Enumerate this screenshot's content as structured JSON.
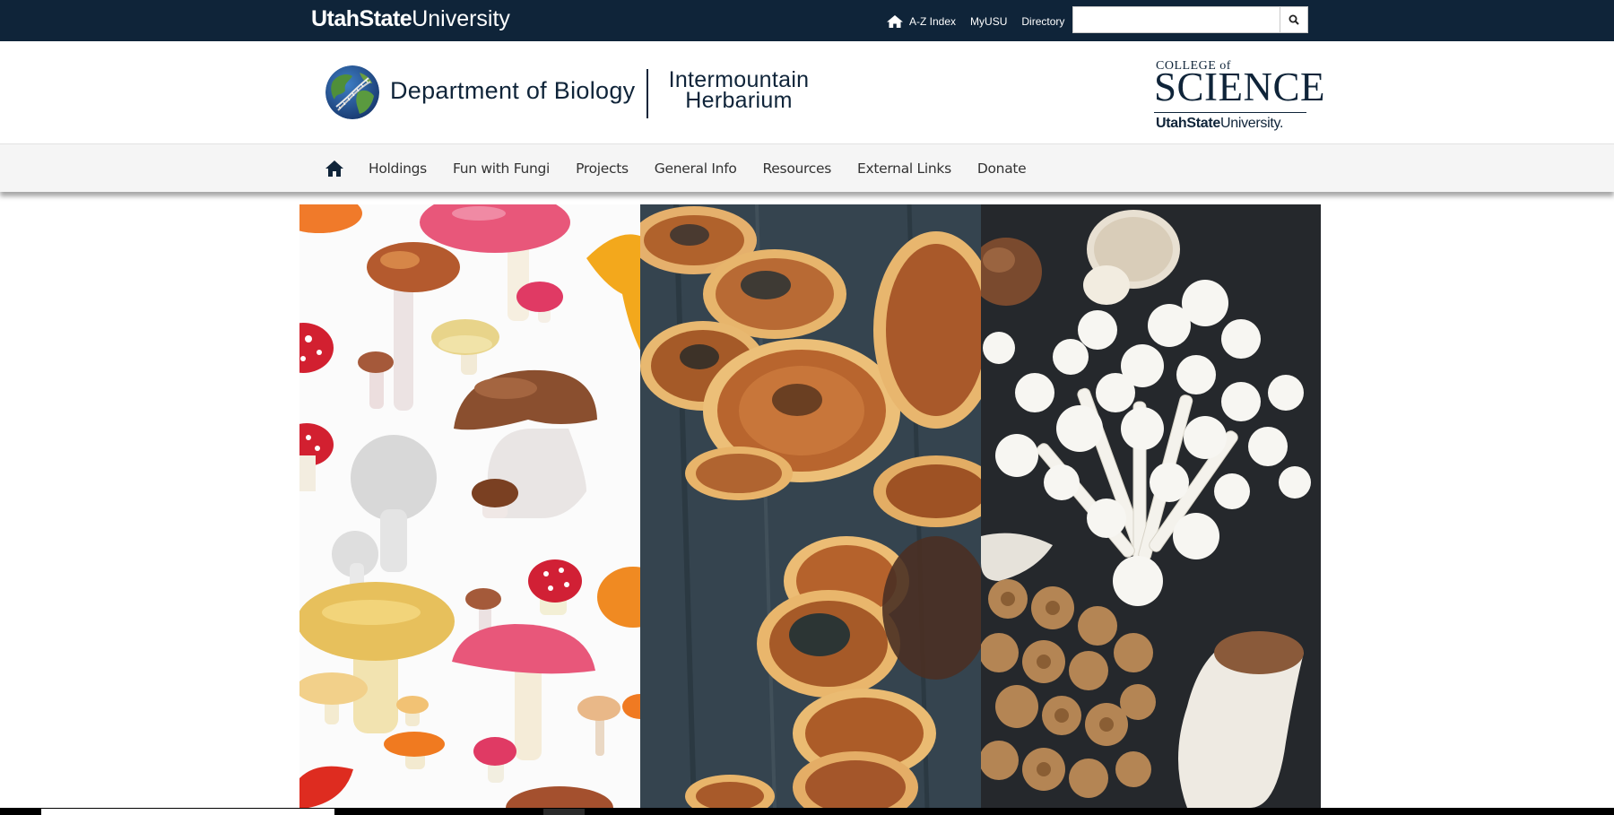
{
  "topbar": {
    "wordmark_bold": "UtahState",
    "wordmark_light": "University",
    "links": [
      "A-Z Index",
      "MyUSU",
      "Directory"
    ],
    "search_value": "",
    "bg_color": "#0f2439"
  },
  "header": {
    "department": "Department of Biology",
    "herbarium_line1": "Intermountain",
    "herbarium_line2": "Herbarium",
    "cos_college": "COLLEGE of",
    "cos_science": "SCIENCE",
    "cos_usu_bold": "UtahState",
    "cos_usu_light": "University."
  },
  "nav": {
    "items": [
      "Holdings",
      "Fun with Fungi",
      "Projects",
      "General Info",
      "Resources",
      "External Links",
      "Donate"
    ]
  },
  "icons": {
    "top_home": "home-icon",
    "search": "search-icon",
    "nav_home": "home-icon"
  }
}
